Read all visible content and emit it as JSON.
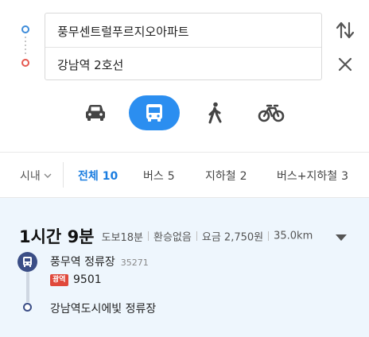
{
  "route": {
    "start_label": "풍무센트럴푸르지오아파트",
    "end_label": "강남역 2호선",
    "swap_icon": "swap-vertical-icon",
    "clear_icon": "close-icon"
  },
  "modes": [
    {
      "id": "car",
      "icon": "car-icon",
      "selected": false
    },
    {
      "id": "transit",
      "icon": "bus-icon",
      "selected": true
    },
    {
      "id": "walk",
      "icon": "walk-icon",
      "selected": false
    },
    {
      "id": "bike",
      "icon": "bicycle-icon",
      "selected": false
    }
  ],
  "filters": {
    "region": "시내",
    "tabs": [
      {
        "label": "전체",
        "count": "10"
      },
      {
        "label": "버스",
        "count": "5"
      },
      {
        "label": "지하철",
        "count": "2"
      },
      {
        "label": "버스+지하철",
        "count": "3"
      }
    ]
  },
  "result": {
    "duration": "1시간 9분",
    "walk": "도보18분",
    "transfer": "환승없음",
    "fare": "요금 2,750원",
    "distance": "35.0km",
    "boarding_stop": "풍무역 정류장",
    "boarding_stop_id": "35271",
    "bus_type": "광역",
    "bus_number": "9501",
    "alighting_stop": "강남역도시에빛 정류장"
  },
  "colors": {
    "accent": "#2b8ef0",
    "active_tab": "#1a7de0",
    "start_dot": "#3d8bd9",
    "end_dot": "#e5584f",
    "express_bus": "#e0483b",
    "stop_icon": "#3b4e86",
    "result_bg": "#eef6fd"
  }
}
